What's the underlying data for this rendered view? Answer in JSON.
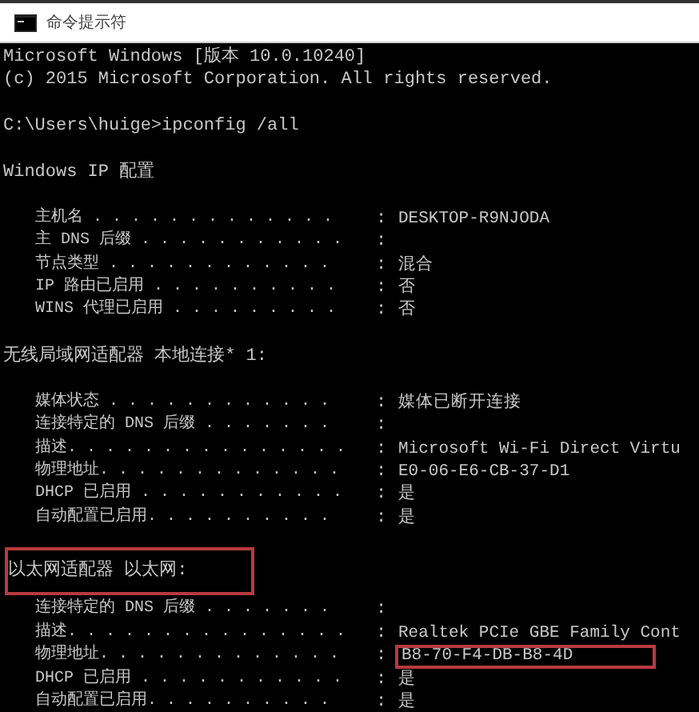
{
  "window": {
    "title": "命令提示符"
  },
  "console": {
    "lines": [
      {
        "kind": "text",
        "text": "Microsoft Windows [版本 10.0.10240]"
      },
      {
        "kind": "text",
        "text": "(c) 2015 Microsoft Corporation. All rights reserved."
      },
      {
        "kind": "blank"
      },
      {
        "kind": "text",
        "text": "C:\\Users\\huige>ipconfig /all"
      },
      {
        "kind": "blank"
      },
      {
        "kind": "text",
        "text": "Windows IP 配置"
      },
      {
        "kind": "blank"
      },
      {
        "kind": "entry",
        "label": "主机名  . . . . . . . . . . . . .",
        "sep": ":",
        "value": "DESKTOP-R9NJODA"
      },
      {
        "kind": "entry",
        "label": "主 DNS 后缀 . . . . . . . . . . .",
        "sep": ":"
      },
      {
        "kind": "entry",
        "label": "节点类型  . . . . . . . . . . . .",
        "sep": ":",
        "value": "混合"
      },
      {
        "kind": "entry",
        "label": "IP 路由已启用 . . . . . . . . . .",
        "sep": ":",
        "value": "否"
      },
      {
        "kind": "entry",
        "label": "WINS 代理已启用 . . . . . . . . .",
        "sep": ":",
        "value": "否"
      },
      {
        "kind": "blank"
      },
      {
        "kind": "text",
        "text": "无线局域网适配器 本地连接* 1:"
      },
      {
        "kind": "blank"
      },
      {
        "kind": "entry",
        "label": "媒体状态  . . . . . . . . . . . .",
        "sep": ":",
        "value": "媒体已断开连接"
      },
      {
        "kind": "entry",
        "label": "连接特定的 DNS 后缀 . . . . . . .",
        "sep": ":"
      },
      {
        "kind": "entry",
        "label": "描述. . . . . . . . . . . . . . .",
        "sep": ":",
        "value": "Microsoft Wi-Fi Direct Virtu"
      },
      {
        "kind": "entry",
        "label": "物理地址. . . . . . . . . . . . .",
        "sep": ":",
        "value": "E0-06-E6-CB-37-D1"
      },
      {
        "kind": "entry",
        "label": "DHCP 已启用 . . . . . . . . . . .",
        "sep": ":",
        "value": "是"
      },
      {
        "kind": "entry",
        "label": "自动配置已启用. . . . . . . . . .",
        "sep": ":",
        "value": "是"
      },
      {
        "kind": "blank"
      },
      {
        "kind": "text",
        "text": "以太网适配器 以太网:",
        "highlighted": true
      },
      {
        "kind": "blank"
      },
      {
        "kind": "entry",
        "label": "连接特定的 DNS 后缀 . . . . . . .",
        "sep": ":"
      },
      {
        "kind": "entry",
        "label": "描述. . . . . . . . . . . . . . .",
        "sep": ":",
        "value": "Realtek PCIe GBE Family Cont"
      },
      {
        "kind": "entry",
        "label": "物理地址. . . . . . . . . . . . .",
        "sep": ":",
        "value": "B8-70-F4-DB-B8-4D",
        "highlighted": true
      },
      {
        "kind": "entry",
        "label": "DHCP 已启用 . . . . . . . . . . .",
        "sep": ":",
        "value": "是"
      },
      {
        "kind": "entry",
        "label": "自动配置已启用. . . . . . . . . .",
        "sep": ":",
        "value": "是"
      }
    ]
  }
}
